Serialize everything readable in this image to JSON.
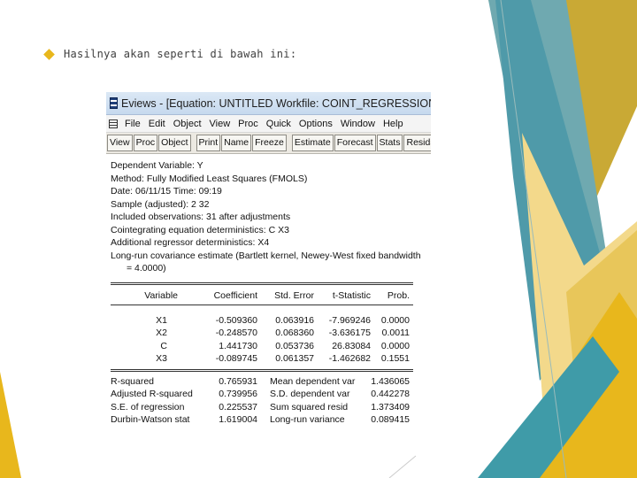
{
  "slide": {
    "bullet_text": "Hasilnya akan seperti di bawah ini:"
  },
  "colors": {
    "accent_gold": "#e8b71c",
    "teal": "#3f9ba8",
    "pale_yellow": "#f5dc8a"
  },
  "eviews": {
    "title": "Eviews - [Equation: UNTITLED   Workfile: COINT_REGRESSION::Coint_regr",
    "menu": [
      "File",
      "Edit",
      "Object",
      "View",
      "Proc",
      "Quick",
      "Options",
      "Window",
      "Help"
    ],
    "toolbar": [
      "View",
      "Proc",
      "Object",
      "Print",
      "Name",
      "Freeze",
      "Estimate",
      "Forecast",
      "Stats",
      "Resids"
    ],
    "header_lines": [
      "Dependent Variable: Y",
      "Method: Fully Modified Least Squares (FMOLS)",
      "Date: 06/11/15   Time: 09:19",
      "Sample (adjusted): 2 32",
      "Included observations: 31 after adjustments",
      "Cointegrating equation deterministics: C X3",
      "Additional regressor deterministics: X4",
      "Long-run covariance estimate (Bartlett kernel, Newey-West fixed bandwidth"
    ],
    "header_indent_line": "= 4.0000)",
    "coef_headers": [
      "Variable",
      "Coefficient",
      "Std. Error",
      "t-Statistic",
      "Prob."
    ],
    "coef_rows": [
      [
        "X1",
        "-0.509360",
        "0.063916",
        "-7.969246",
        "0.0000"
      ],
      [
        "X2",
        "-0.248570",
        "0.068360",
        "-3.636175",
        "0.0011"
      ],
      [
        "C",
        "1.441730",
        "0.053736",
        "26.83084",
        "0.0000"
      ],
      [
        "X3",
        "-0.089745",
        "0.061357",
        "-1.462682",
        "0.1551"
      ]
    ],
    "stats_rows": [
      [
        "R-squared",
        "0.765931",
        "Mean dependent var",
        "1.436065"
      ],
      [
        "Adjusted R-squared",
        "0.739956",
        "S.D. dependent var",
        "0.442278"
      ],
      [
        "S.E. of regression",
        "0.225537",
        "Sum squared resid",
        "1.373409"
      ],
      [
        "Durbin-Watson stat",
        "1.619004",
        "Long-run variance",
        "0.089415"
      ]
    ]
  }
}
